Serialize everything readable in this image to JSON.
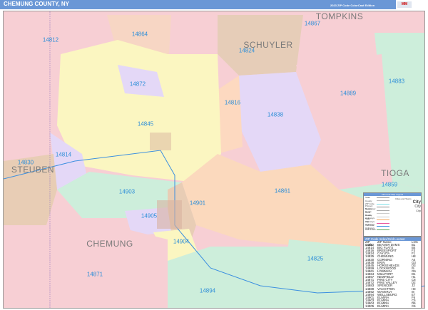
{
  "header": {
    "title": "CHEMUNG COUNTY, NY",
    "edition": "2023 ZIP Code ColorCast Edition",
    "logo": "Market Maps"
  },
  "counties": [
    {
      "name": "TOMPKINS"
    },
    {
      "name": "SCHUYLER"
    },
    {
      "name": "STEUBEN"
    },
    {
      "name": "TIOGA"
    },
    {
      "name": "CHEMUNG"
    }
  ],
  "zip_labels": [
    "14812",
    "14864",
    "14867",
    "14824",
    "14883",
    "14872",
    "14889",
    "14816",
    "14838",
    "14845",
    "14814",
    "14830",
    "14859",
    "14903",
    "14861",
    "14901",
    "14905",
    "14904",
    "14825",
    "14871",
    "14894"
  ],
  "legend": {
    "title": "ZIP Code Map Legend",
    "items": [
      "State",
      "County",
      "ZIP Code",
      "Primary Roads",
      "Secondary Roads",
      "Minor Roads",
      "County Highways",
      "State Highways",
      "US Highways",
      "Interstate Highways",
      "Rail Roads"
    ],
    "cities": [
      "Cities and Towns",
      "City",
      "City",
      "City"
    ]
  },
  "index": {
    "title": "ZIP Code Index/Grid Locator",
    "headers": [
      "ZIP Code",
      "ZIP Name",
      "LOC"
    ],
    "rows": [
      [
        "14812",
        "BEAVER DAMS",
        "B1"
      ],
      [
        "14814",
        "BIG FLATS",
        "B4"
      ],
      [
        "14816",
        "BREESPORT",
        "F3"
      ],
      [
        "14824",
        "CAYUTA",
        "F1"
      ],
      [
        "14825",
        "CHEMUNG",
        "H8"
      ],
      [
        "14830",
        "CORNING",
        "A4"
      ],
      [
        "14838",
        "ERIN",
        "G3"
      ],
      [
        "14845",
        "HORSEHEADS",
        "D3"
      ],
      [
        "14859",
        "LOCKWOOD",
        "I5"
      ],
      [
        "14861",
        "LOWMAN",
        "G6"
      ],
      [
        "14864",
        "MILLPORT",
        "D1"
      ],
      [
        "14867",
        "NEWFIELD",
        "H1"
      ],
      [
        "14871",
        "PINE CITY",
        "C8"
      ],
      [
        "14872",
        "PINE VALLEY",
        "D2"
      ],
      [
        "14883",
        "SPENCER",
        "J2"
      ],
      [
        "14889",
        "VAN ETTEN",
        "H3"
      ],
      [
        "14892",
        "WAVERLY",
        "I8"
      ],
      [
        "14894",
        "WELLSBURG",
        "E7"
      ],
      [
        "14901",
        "ELMIRA",
        "F6"
      ],
      [
        "14903",
        "ELMIRA",
        "C5"
      ],
      [
        "14904",
        "ELMIRA",
        "D6"
      ],
      [
        "14905",
        "ELMIRA",
        "C6"
      ]
    ]
  },
  "colors": {
    "header": "#6a97d6",
    "zip_label": "#2f8fd8"
  }
}
